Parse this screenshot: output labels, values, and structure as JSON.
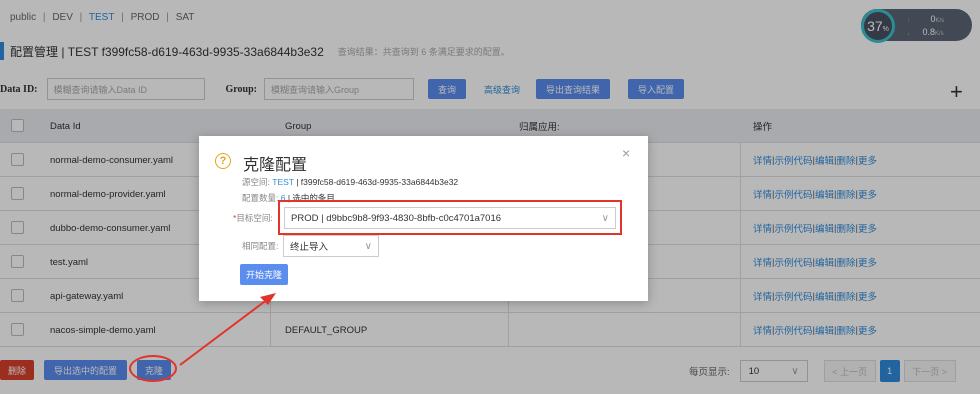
{
  "namespaces": [
    "public",
    "DEV",
    "TEST",
    "PROD",
    "SAT"
  ],
  "namespace_active": "TEST",
  "page": {
    "title": "配置管理  |  TEST  f399fc58-d619-463d-9935-33a6844b3e32",
    "hint": "查询结果：共查询到 6 条满足要求的配置。"
  },
  "gauge": {
    "percent": "37",
    "percent_unit": "%",
    "up_value": "0",
    "up_unit": "K/s",
    "down_value": "0.8",
    "down_unit": "K/s"
  },
  "search": {
    "data_id_label": "Data ID:",
    "data_id_placeholder": "模糊查询请输入Data ID",
    "group_label": "Group:",
    "group_placeholder": "模糊查询请输入Group",
    "query_button": "查询",
    "advanced_link": "高级查询",
    "export_button": "导出查询结果",
    "import_button": "导入配置",
    "add_icon_glyph": "+"
  },
  "table": {
    "headers": [
      "Data Id",
      "Group",
      "归属应用:",
      "操作"
    ],
    "rows": [
      {
        "data_id": "normal-demo-consumer.yaml",
        "group": ""
      },
      {
        "data_id": "normal-demo-provider.yaml",
        "group": ""
      },
      {
        "data_id": "dubbo-demo-consumer.yaml",
        "group": ""
      },
      {
        "data_id": "test.yaml",
        "group": ""
      },
      {
        "data_id": "api-gateway.yaml",
        "group": ""
      },
      {
        "data_id": "nacos-simple-demo.yaml",
        "group": "DEFAULT_GROUP"
      }
    ],
    "ops": [
      "详情",
      "示例代码",
      "编辑",
      "删除",
      "更多"
    ]
  },
  "footer": {
    "delete_button": "删除",
    "export_selected_button": "导出选中的配置",
    "clone_button": "克隆",
    "page_size_label": "每页显示:",
    "page_size_value": "10",
    "prev_label": "< 上一页",
    "current_page": "1",
    "next_label": "下一页 >"
  },
  "dialog": {
    "help_glyph": "?",
    "title": "克隆配置",
    "close_glyph": "×",
    "source_label": "源空间:",
    "source_ns": "TEST",
    "source_id": "| f399fc58-d619-463d-9935-33a6844b3e32",
    "count_label": "配置数量:",
    "count_value": "6",
    "count_suffix": "| 选中的条目",
    "target_label": "目标空间:",
    "target_value": "PROD | d9bbc9b8-9f93-4830-8bfb-c0c4701a7016",
    "same_label": "相同配置:",
    "same_value": "终止导入",
    "start_button": "开始克隆"
  },
  "colors": {
    "accent": "#2e8bdb",
    "button": "#5b8def",
    "danger": "#d9412b",
    "annotation": "#e1342b"
  }
}
